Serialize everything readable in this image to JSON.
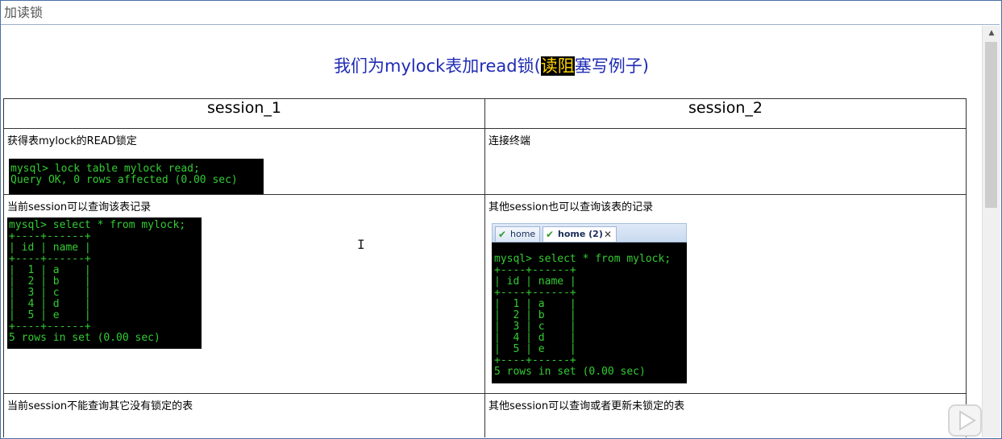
{
  "window": {
    "title": "加读锁"
  },
  "heading": {
    "before": "我们为mylock表加read锁(",
    "highlight": "读阻",
    "after": "塞写例子)"
  },
  "table": {
    "headers": [
      "session_1",
      "session_2"
    ],
    "rows": [
      {
        "left_text": "获得表mylock的READ锁定",
        "left_terminal": "mysql> lock table mylock read;\nQuery OK, 0 rows affected (0.00 sec)",
        "right_text": "连接终端"
      },
      {
        "left_text": "当前session可以查询该表记录",
        "left_terminal": "mysql> select * from mylock;\n+----+------+\n| id | name |\n+----+------+\n|  1 | a    |\n|  2 | b    |\n|  3 | c    |\n|  4 | d    |\n|  5 | e    |\n+----+------+\n5 rows in set (0.00 sec)",
        "right_text": "其他session也可以查询该表的记录",
        "right_tabs": [
          "home",
          "home (2)"
        ],
        "right_terminal": "mysql> select * from mylock;\n+----+------+\n| id | name |\n+----+------+\n|  1 | a    |\n|  2 | b    |\n|  3 | c    |\n|  4 | d    |\n|  5 | e    |\n+----+------+\n5 rows in set (0.00 sec)"
      },
      {
        "left_text": "当前session不能查询其它没有锁定的表",
        "right_text": "其他session可以查询或者更新未锁定的表"
      }
    ]
  },
  "icons": {
    "tab_status": "check-icon",
    "tab_close": "close-icon",
    "scroll_up": "chevron-up-icon",
    "cursor": "text-cursor-icon",
    "overlay": "play-icon"
  },
  "colors": {
    "heading": "#1f2bb5",
    "highlight_bg": "#000000",
    "highlight_fg": "#ffd400",
    "terminal_bg": "#000000",
    "terminal_fg": "#33cc33"
  }
}
